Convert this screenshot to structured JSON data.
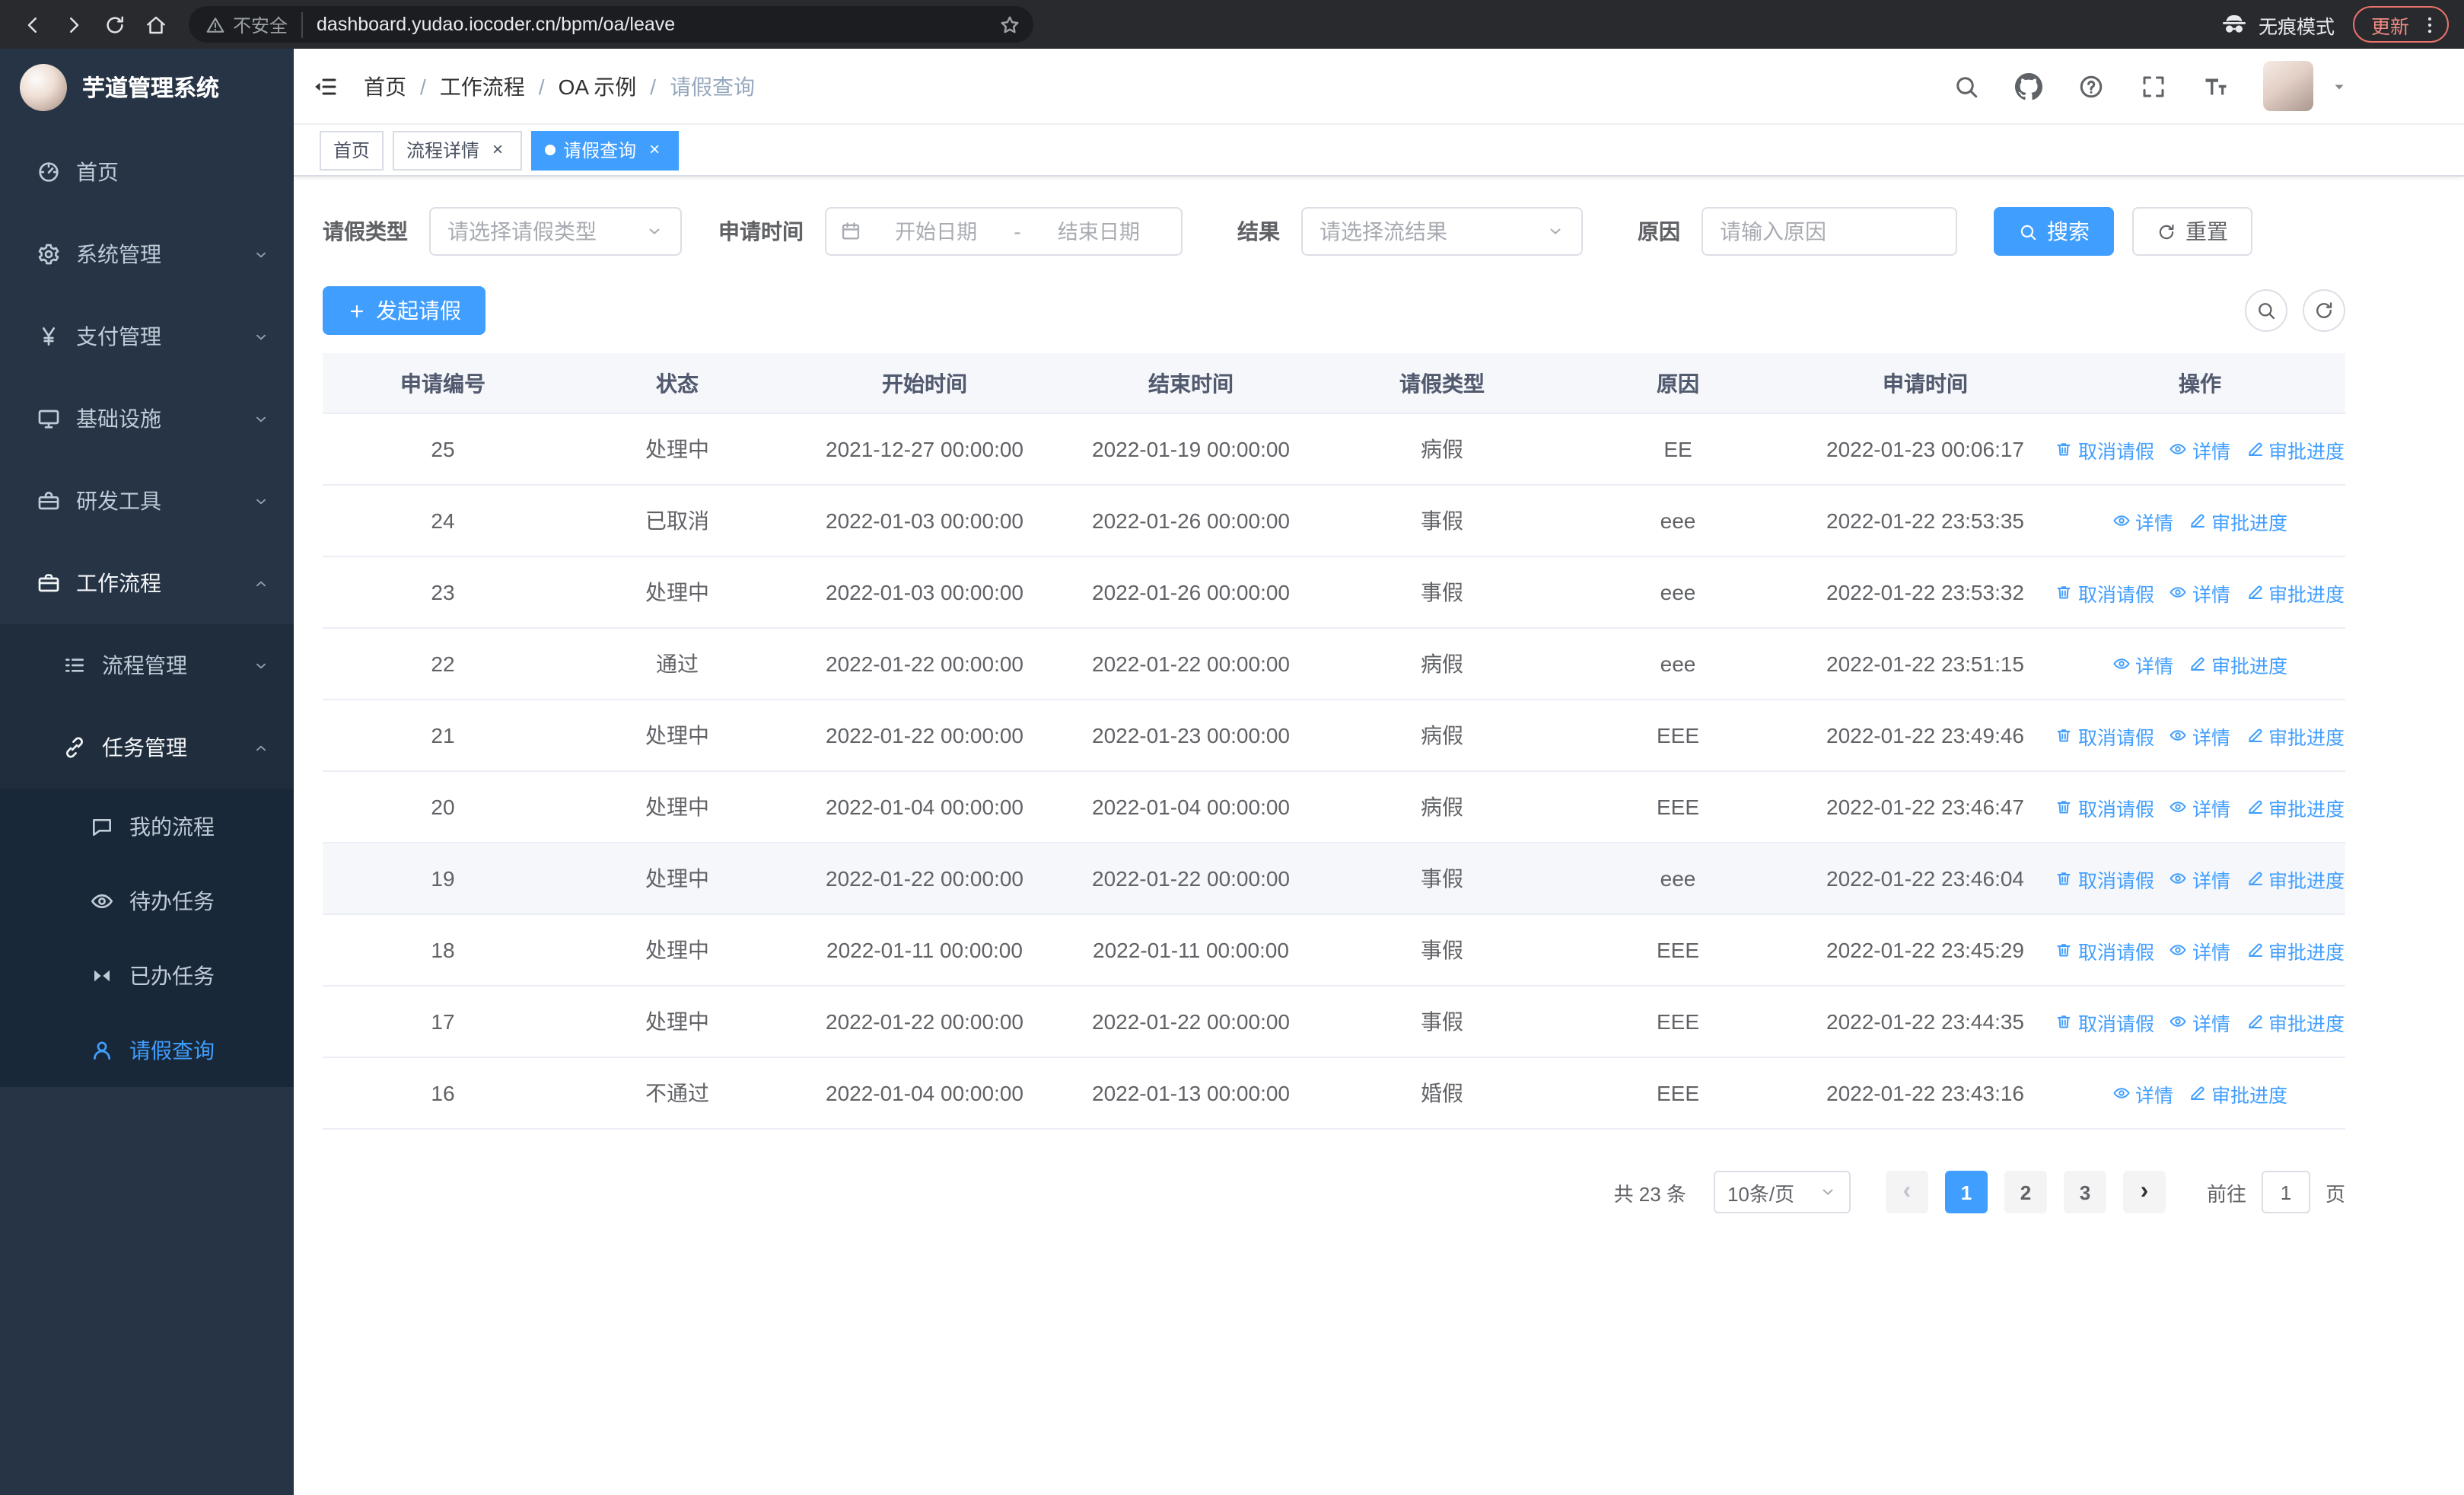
{
  "browser": {
    "url": "dashboard.yudao.iocoder.cn/bpm/oa/leave",
    "security_warning": "不安全",
    "incognito_label": "无痕模式",
    "update_label": "更新"
  },
  "sidebar": {
    "logo_title": "芋道管理系统",
    "items": [
      {
        "label": "首页"
      },
      {
        "label": "系统管理"
      },
      {
        "label": "支付管理"
      },
      {
        "label": "基础设施"
      },
      {
        "label": "研发工具"
      },
      {
        "label": "工作流程"
      },
      {
        "label": "流程管理"
      },
      {
        "label": "任务管理"
      },
      {
        "label": "我的流程"
      },
      {
        "label": "待办任务"
      },
      {
        "label": "已办任务"
      },
      {
        "label": "请假查询"
      }
    ]
  },
  "navbar": {
    "breadcrumb": [
      "首页",
      "工作流程",
      "OA 示例",
      "请假查询"
    ],
    "separator": "/"
  },
  "tabs": [
    {
      "label": "首页"
    },
    {
      "label": "流程详情"
    },
    {
      "label": "请假查询"
    }
  ],
  "filters": {
    "leave_type": {
      "label": "请假类型",
      "placeholder": "请选择请假类型"
    },
    "apply_time": {
      "label": "申请时间",
      "start_placeholder": "开始日期",
      "separator": "-",
      "end_placeholder": "结束日期"
    },
    "result": {
      "label": "结果",
      "placeholder": "请选择流结果"
    },
    "reason": {
      "label": "原因",
      "placeholder": "请输入原因"
    },
    "search_label": "搜索",
    "reset_label": "重置"
  },
  "toolbar": {
    "create_label": "发起请假"
  },
  "table": {
    "columns": [
      "申请编号",
      "状态",
      "开始时间",
      "结束时间",
      "请假类型",
      "原因",
      "申请时间",
      "操作"
    ],
    "action_labels": {
      "cancel": "取消请假",
      "detail": "详情",
      "progress": "审批进度"
    },
    "rows": [
      {
        "id": "25",
        "status": "处理中",
        "start": "2021-12-27 00:00:00",
        "end": "2022-01-19 00:00:00",
        "type": "病假",
        "reason": "EE",
        "applied": "2022-01-23 00:06:17",
        "actions": [
          "cancel",
          "detail",
          "progress"
        ]
      },
      {
        "id": "24",
        "status": "已取消",
        "start": "2022-01-03 00:00:00",
        "end": "2022-01-26 00:00:00",
        "type": "事假",
        "reason": "eee",
        "applied": "2022-01-22 23:53:35",
        "actions": [
          "detail",
          "progress"
        ]
      },
      {
        "id": "23",
        "status": "处理中",
        "start": "2022-01-03 00:00:00",
        "end": "2022-01-26 00:00:00",
        "type": "事假",
        "reason": "eee",
        "applied": "2022-01-22 23:53:32",
        "actions": [
          "cancel",
          "detail",
          "progress"
        ]
      },
      {
        "id": "22",
        "status": "通过",
        "start": "2022-01-22 00:00:00",
        "end": "2022-01-22 00:00:00",
        "type": "病假",
        "reason": "eee",
        "applied": "2022-01-22 23:51:15",
        "actions": [
          "detail",
          "progress"
        ]
      },
      {
        "id": "21",
        "status": "处理中",
        "start": "2022-01-22 00:00:00",
        "end": "2022-01-23 00:00:00",
        "type": "病假",
        "reason": "EEE",
        "applied": "2022-01-22 23:49:46",
        "actions": [
          "cancel",
          "detail",
          "progress"
        ]
      },
      {
        "id": "20",
        "status": "处理中",
        "start": "2022-01-04 00:00:00",
        "end": "2022-01-04 00:00:00",
        "type": "病假",
        "reason": "EEE",
        "applied": "2022-01-22 23:46:47",
        "actions": [
          "cancel",
          "detail",
          "progress"
        ]
      },
      {
        "id": "19",
        "status": "处理中",
        "start": "2022-01-22 00:00:00",
        "end": "2022-01-22 00:00:00",
        "type": "事假",
        "reason": "eee",
        "applied": "2022-01-22 23:46:04",
        "actions": [
          "cancel",
          "detail",
          "progress"
        ],
        "hover": true
      },
      {
        "id": "18",
        "status": "处理中",
        "start": "2022-01-11 00:00:00",
        "end": "2022-01-11 00:00:00",
        "type": "事假",
        "reason": "EEE",
        "applied": "2022-01-22 23:45:29",
        "actions": [
          "cancel",
          "detail",
          "progress"
        ]
      },
      {
        "id": "17",
        "status": "处理中",
        "start": "2022-01-22 00:00:00",
        "end": "2022-01-22 00:00:00",
        "type": "事假",
        "reason": "EEE",
        "applied": "2022-01-22 23:44:35",
        "actions": [
          "cancel",
          "detail",
          "progress"
        ]
      },
      {
        "id": "16",
        "status": "不通过",
        "start": "2022-01-04 00:00:00",
        "end": "2022-01-13 00:00:00",
        "type": "婚假",
        "reason": "EEE",
        "applied": "2022-01-22 23:43:16",
        "actions": [
          "detail",
          "progress"
        ]
      }
    ]
  },
  "pagination": {
    "total_label": "共 23 条",
    "page_size": "10条/页",
    "pages": [
      "1",
      "2",
      "3"
    ],
    "current_page": "1",
    "goto_label": "前往",
    "goto_value": "1",
    "page_unit": "页"
  },
  "colors": {
    "primary": "#409eff",
    "sidebar_bg": "#263445"
  }
}
